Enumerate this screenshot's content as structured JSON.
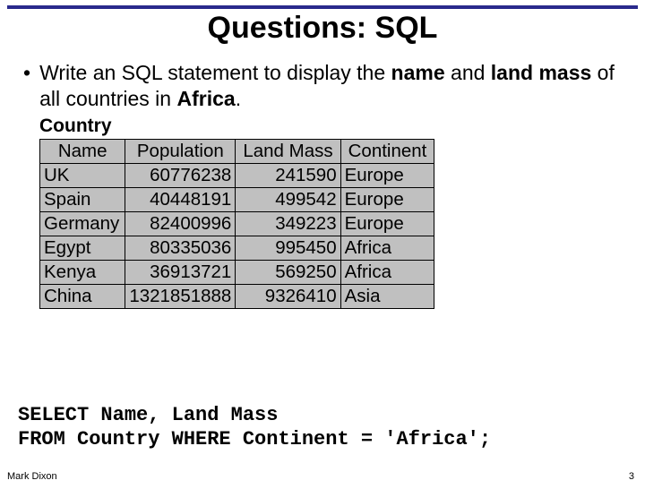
{
  "title": "Questions: SQL",
  "prompt_html": "Write an SQL statement to display the <b>name</b> and <b>land mass</b> of all countries in <b>Africa</b>.",
  "table": {
    "caption": "Country",
    "headers": [
      "Name",
      "Population",
      "Land Mass",
      "Continent"
    ],
    "rows": [
      [
        "UK",
        "60776238",
        "241590",
        "Europe"
      ],
      [
        "Spain",
        "40448191",
        "499542",
        "Europe"
      ],
      [
        "Germany",
        "82400996",
        "349223",
        "Europe"
      ],
      [
        "Egypt",
        "80335036",
        "995450",
        "Africa"
      ],
      [
        "Kenya",
        "36913721",
        "569250",
        "Africa"
      ],
      [
        "China",
        "1321851888",
        "9326410",
        "Asia"
      ]
    ]
  },
  "sql": {
    "line1": "SELECT Name, Land Mass",
    "line2": "FROM Country WHERE Continent = 'Africa';"
  },
  "footer": {
    "author": "Mark Dixon",
    "page": "3"
  }
}
